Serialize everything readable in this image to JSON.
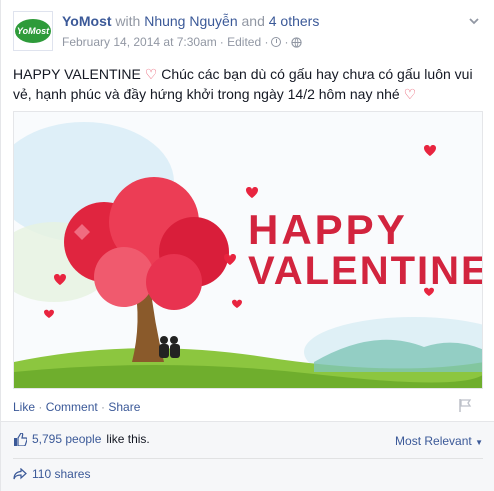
{
  "post": {
    "page_name": "YoMost",
    "with_text": "with",
    "tagged_name": "Nhung Nguyễn",
    "and_text": "and",
    "others_text": "4 others",
    "timestamp": "February 14, 2014 at 7:30am",
    "edited": "· Edited ·",
    "logo_text": "YoMost",
    "message_line1": "HAPPY VALENTINE",
    "message_line1_rest": " Chúc các bạn dù có gấu hay chưa có gấu luôn vui vẻ, hạnh phúc và đầy hứng khởi trong ngày 14/2 hôm nay nhé",
    "image_text_1": "HAPPY",
    "image_text_2": "VALENTINE",
    "heart_color": "#e5475d"
  },
  "actions": {
    "like": "Like",
    "comment": "Comment",
    "share": "Share",
    "sep": " · "
  },
  "ufi": {
    "likes_count": "5,795 people",
    "likes_suffix": "like this.",
    "sort_label": "Most Relevant",
    "shares": "110 shares"
  },
  "colors": {
    "link": "#3b5998",
    "meta": "#9197a3",
    "ufi_bg": "#f6f7f9",
    "valentine_text": "#d2243e"
  },
  "icons": [
    "clock-icon",
    "globe-icon",
    "chevron-down-icon",
    "flag-icon",
    "thumbs-up-icon",
    "share-arrow-icon"
  ]
}
